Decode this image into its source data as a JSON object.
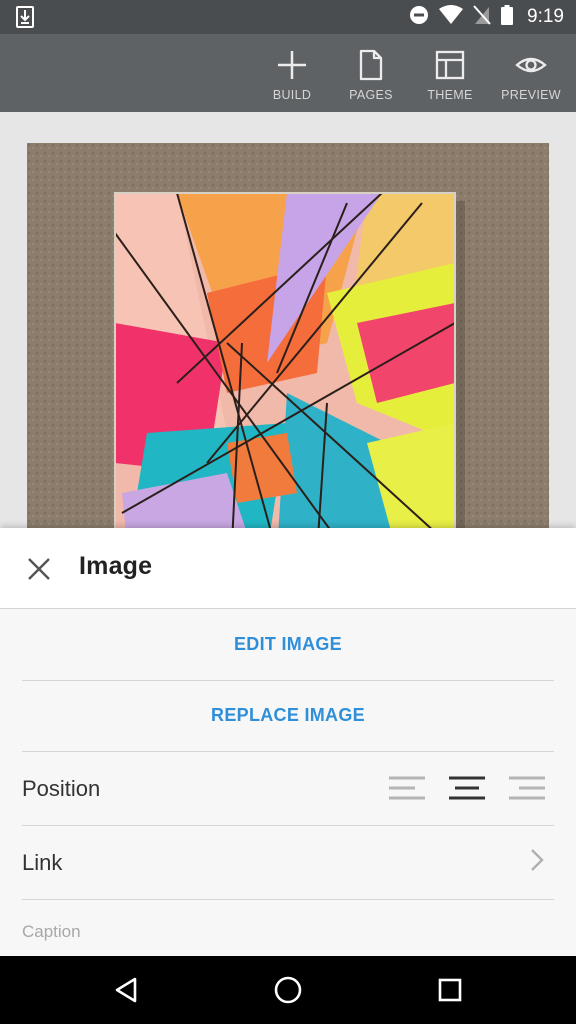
{
  "status_bar": {
    "time": "9:19",
    "icons": [
      "download-notification-icon",
      "do-not-disturb-icon",
      "wifi-icon",
      "no-sim-icon",
      "battery-icon"
    ]
  },
  "toolbar": {
    "items": [
      {
        "label": "BUILD",
        "icon": "plus-icon"
      },
      {
        "label": "PAGES",
        "icon": "page-icon"
      },
      {
        "label": "THEME",
        "icon": "layout-icon"
      },
      {
        "label": "PREVIEW",
        "icon": "eye-icon"
      }
    ]
  },
  "sheet": {
    "title": "Image",
    "close_icon": "close-icon",
    "edit_label": "EDIT IMAGE",
    "replace_label": "REPLACE IMAGE",
    "position_label": "Position",
    "position_options": [
      "left",
      "center",
      "right"
    ],
    "position_selected": "center",
    "link_label": "Link",
    "caption_label": "Caption"
  },
  "nav": {
    "icons": [
      "back-icon",
      "home-icon",
      "recents-icon"
    ]
  },
  "colors": {
    "accent": "#2f8fd8",
    "toolbar_bg": "#5f6265",
    "status_bg": "#4a4d50"
  }
}
